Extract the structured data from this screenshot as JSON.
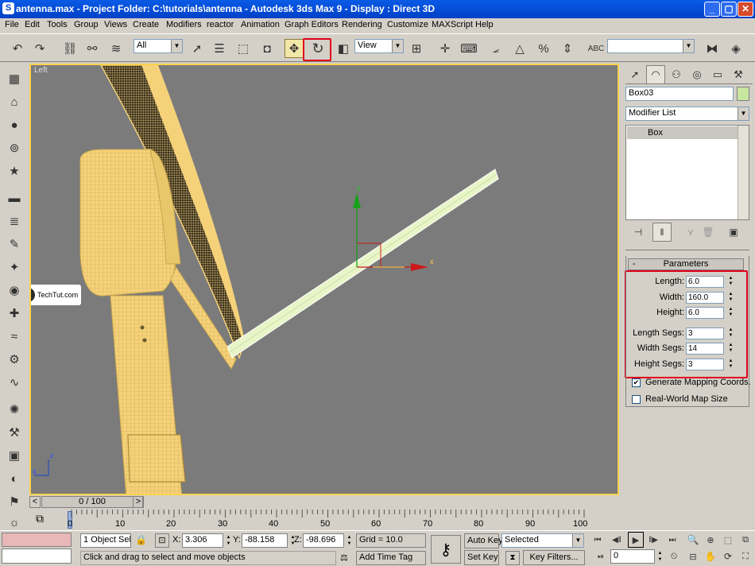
{
  "window": {
    "title": "antenna.max     - Project Folder: C:\\tutorials\\antenna      - Autodesk 3ds Max 9      - Display : Direct 3D",
    "min_glyph": "_",
    "max_glyph": "▢",
    "close_glyph": "✕"
  },
  "menu": [
    "File",
    "Edit",
    "Tools",
    "Group",
    "Views",
    "Create",
    "Modifiers",
    "reactor",
    "Animation",
    "Graph Editors",
    "Rendering",
    "Customize",
    "MAXScript",
    "Help"
  ],
  "toolbar": {
    "selection_filter": "All",
    "ref_coord": "View",
    "named_selection": "",
    "highlighted_tool": "select-and-rotate-icon"
  },
  "viewport": {
    "label": "Left",
    "gizmo": {
      "y_label": "y",
      "x_label": "x"
    },
    "axis_tripod": {
      "x": "x",
      "z": "z"
    },
    "watermark": "TechTut.com"
  },
  "command_panel": {
    "object_name": "Box03",
    "object_color": "#c8e6a0",
    "modifier_list": "Modifier List",
    "stack": [
      "Box"
    ],
    "rollout_title": "Parameters",
    "rollout_toggle": "-",
    "params": [
      {
        "label": "Length:",
        "value": "6.0"
      },
      {
        "label": "Width:",
        "value": "160.0"
      },
      {
        "label": "Height:",
        "value": "6.0"
      },
      {
        "label": "Length Segs:",
        "value": "3"
      },
      {
        "label": "Width Segs:",
        "value": "14"
      },
      {
        "label": "Height Segs:",
        "value": "3"
      }
    ],
    "generate_mapping": {
      "label": "Generate Mapping Coords.",
      "checked": true
    },
    "real_world": {
      "label": "Real-World Map Size",
      "checked": false
    }
  },
  "timeline": {
    "slider": "0 / 100",
    "prev_glyph": "<",
    "next_glyph": ">",
    "ticks": [
      "0",
      "10",
      "20",
      "30",
      "40",
      "50",
      "60",
      "70",
      "80",
      "90",
      "100"
    ]
  },
  "status": {
    "selection": "1 Object Sele",
    "x_label": "X:",
    "x": "3.306",
    "y_label": "Y:",
    "y": "-88.158",
    "z_label": "Z:",
    "z": "-98.696",
    "grid": "Grid = 10.0",
    "prompt": "Click and drag to select and move objects",
    "add_time_tag": "Add Time Tag",
    "auto_key": "Auto Key",
    "set_key": "Set Key",
    "key_mode": "Selected",
    "key_filters": "Key Filters...",
    "frame": "0"
  },
  "colors": {
    "highlight": "#e0001a",
    "viewport_border": "#ffd24a",
    "mesh": "#f5d27a",
    "selected": "#e8f5c8"
  }
}
